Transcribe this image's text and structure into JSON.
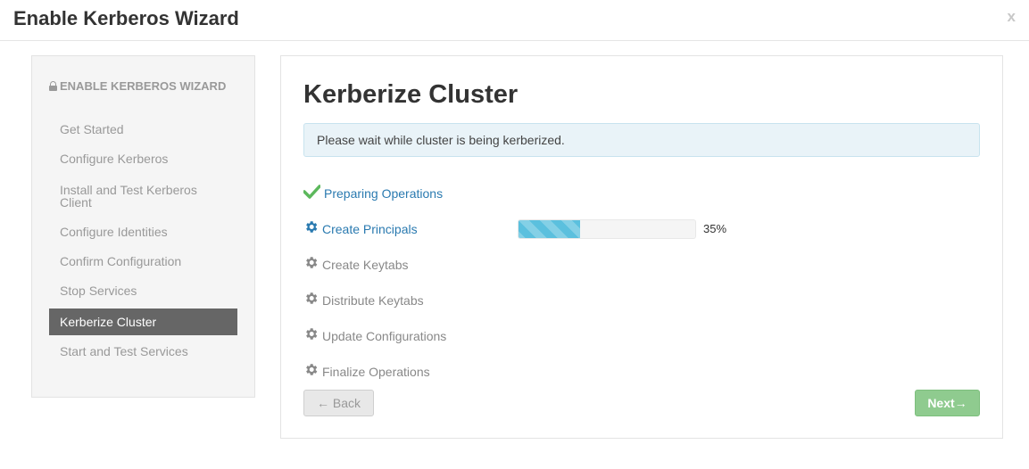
{
  "header": {
    "title": "Enable Kerberos Wizard",
    "close_label": "x"
  },
  "sidebar": {
    "title": "ENABLE KERBEROS WIZARD",
    "items": [
      {
        "label": "Get Started"
      },
      {
        "label": "Configure Kerberos"
      },
      {
        "label": "Install and Test Kerberos Client"
      },
      {
        "label": "Configure Identities"
      },
      {
        "label": "Confirm Configuration"
      },
      {
        "label": "Stop Services"
      },
      {
        "label": "Kerberize Cluster",
        "active": true
      },
      {
        "label": "Start and Test Services"
      }
    ]
  },
  "main": {
    "title": "Kerberize Cluster",
    "alert": "Please wait while cluster is being kerberized.",
    "steps": [
      {
        "label": "Preparing Operations",
        "status": "done",
        "icon": "check-icon"
      },
      {
        "label": "Create Principals",
        "status": "in-progress",
        "icon": "gear-icon"
      },
      {
        "label": "Create Keytabs",
        "status": "pending",
        "icon": "gear-icon"
      },
      {
        "label": "Distribute Keytabs",
        "status": "pending",
        "icon": "gear-icon"
      },
      {
        "label": "Update Configurations",
        "status": "pending",
        "icon": "gear-icon"
      },
      {
        "label": "Finalize Operations",
        "status": "pending",
        "icon": "gear-icon"
      }
    ],
    "progress": {
      "percent": 35,
      "text": "35%"
    },
    "buttons": {
      "back": "← Back",
      "next": "Next→"
    }
  },
  "colors": {
    "link": "#2a7ab0",
    "success": "#5cb85c",
    "progress": "#5bc0de",
    "sidebar_active_bg": "#666666"
  }
}
